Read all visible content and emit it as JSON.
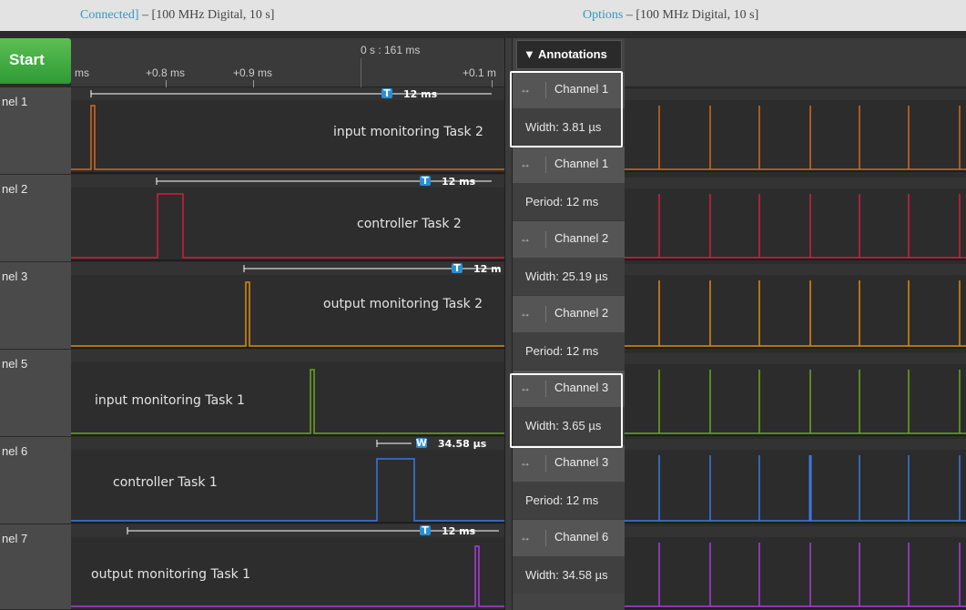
{
  "titlebar": {
    "left_a": "Connected]",
    "left_b": " – [100 MHz Digital, 10 s]",
    "right_a": "Options",
    "right_b": " – [100 MHz Digital, 10 s]"
  },
  "toolbar": {
    "start_label": "Start"
  },
  "ruler": {
    "center": "0 s : 161 ms",
    "ticks": [
      "ms",
      "+0.8 ms",
      "+0.9 ms",
      "+0.1 m"
    ]
  },
  "channels": [
    {
      "label": "nel 1",
      "color": "#d2691e",
      "task": "input monitoring Task 2",
      "measure": "12 ms",
      "badge": "T"
    },
    {
      "label": "nel 2",
      "color": "#d11f3e",
      "task": "controller Task 2",
      "measure": "12 ms",
      "badge": "T"
    },
    {
      "label": "nel 3",
      "color": "#e08a12",
      "task": "output monitoring Task 2",
      "measure": "12 m",
      "badge": "T"
    },
    {
      "label": "nel 5",
      "color": "#6aa61f",
      "task": "input monitoring Task 1",
      "measure": "",
      "badge": ""
    },
    {
      "label": "nel 6",
      "color": "#3b78e0",
      "task": "controller Task 1",
      "measure": "34.58 µs",
      "badge": "W"
    },
    {
      "label": "nel 7",
      "color": "#a93ce0",
      "task": "output monitoring Task 1",
      "measure": "12 ms",
      "badge": "T"
    }
  ],
  "annotations": {
    "header": "▼ Annotations",
    "rows": [
      {
        "channel": "Channel 1",
        "value": "Width: 3.81 µs"
      },
      {
        "channel": "Channel 1",
        "value": "Period: 12 ms"
      },
      {
        "channel": "Channel 2",
        "value": "Width: 25.19 µs"
      },
      {
        "channel": "Channel 2",
        "value": "Period: 12 ms"
      },
      {
        "channel": "Channel 3",
        "value": "Width: 3.65 µs"
      },
      {
        "channel": "Channel 3",
        "value": "Period: 12 ms"
      },
      {
        "channel": "Channel 6",
        "value": "Width: 34.58 µs"
      }
    ]
  },
  "icons": {
    "arrow": "↔",
    "measure_badge": "tag-icon"
  }
}
